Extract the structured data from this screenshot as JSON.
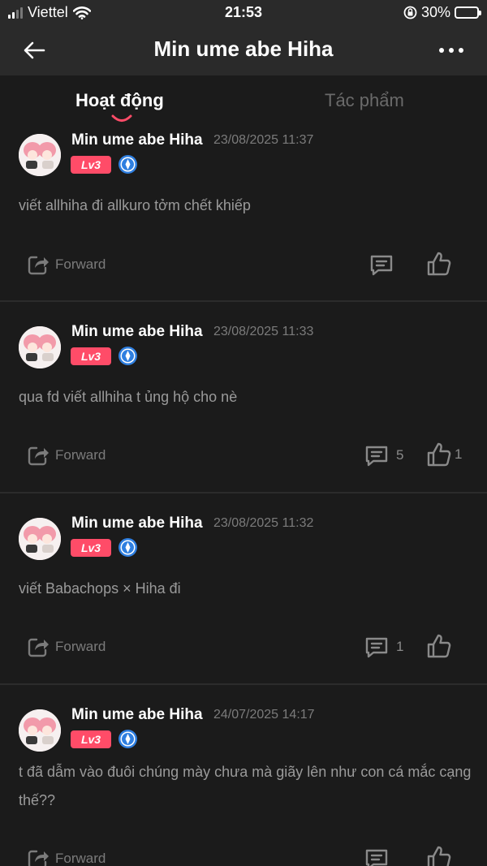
{
  "status_bar": {
    "carrier": "Viettel",
    "time": "21:53",
    "battery": "30%",
    "battery_level": 0.3
  },
  "header": {
    "title": "Min ume abe Hiha"
  },
  "tabs": [
    {
      "label": "Hoạt động",
      "active": true
    },
    {
      "label": "Tác phẩm",
      "active": false
    }
  ],
  "posts": [
    {
      "author": "Min ume abe Hiha",
      "timestamp": "23/08/2025 11:37",
      "level": "Lv3",
      "text": "viết allhiha đi allkuro tởm chết khiếp",
      "forward_label": "Forward",
      "comments": "",
      "likes": ""
    },
    {
      "author": "Min ume abe Hiha",
      "timestamp": "23/08/2025 11:33",
      "level": "Lv3",
      "text": "qua fd viết allhiha t ủng hộ cho nè",
      "forward_label": "Forward",
      "comments": "5",
      "likes": "1"
    },
    {
      "author": "Min ume abe Hiha",
      "timestamp": "23/08/2025 11:32",
      "level": "Lv3",
      "text": "viết Babachops × Hiha đi",
      "forward_label": "Forward",
      "comments": "1",
      "likes": ""
    },
    {
      "author": "Min ume abe Hiha",
      "timestamp": "24/07/2025 14:17",
      "level": "Lv3",
      "text": "t đã dẫm vào đuôi chúng mày chưa mà giãy lên như con cá mắc cạng thế??",
      "forward_label": "Forward",
      "comments": "",
      "likes": ""
    }
  ],
  "colors": {
    "background": "#1b1b1b",
    "bar": "#2a2a2a",
    "level_badge": "#ff4c68",
    "vip_badge": "#2f7fe0",
    "tab_indicator": "#ff4c68"
  }
}
